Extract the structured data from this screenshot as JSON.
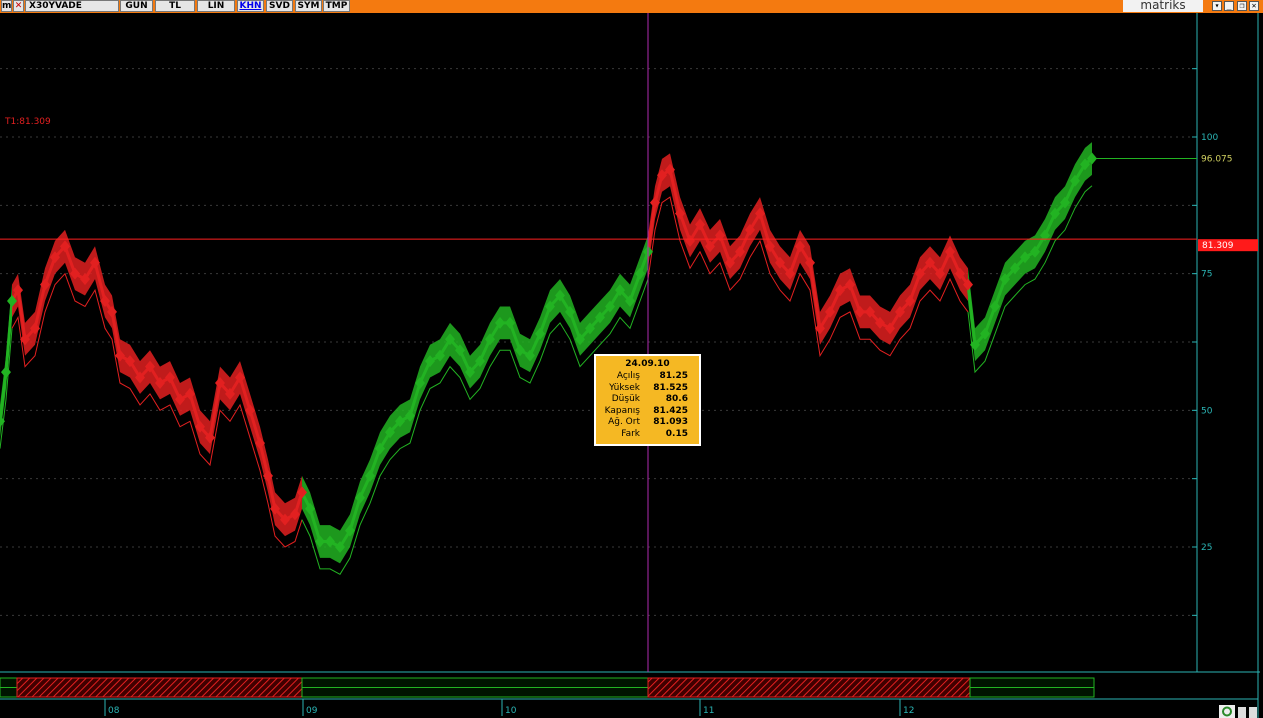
{
  "toolbar": {
    "symbol": "X30YVADE",
    "buttons": [
      "GUN",
      "TL",
      "LIN",
      "KHN",
      "SVD",
      "SYM",
      "TMP"
    ],
    "active_button": "KHN",
    "brand": "matriks"
  },
  "colors": {
    "titlebar": "#f47a10",
    "up": "#22b322",
    "down": "#e22020",
    "axis": "#2bb5b5",
    "trendline": "#ff2020",
    "cursor": "#b02cb0"
  },
  "chart_data": {
    "type": "line",
    "symbol": "X30YVADE",
    "style": "colored price band (green = rising, red = falling)",
    "ylim": [
      -10,
      120
    ],
    "y_ticks": [
      25,
      50,
      75,
      100
    ],
    "x_ticks": [
      "08",
      "09",
      "10",
      "11",
      "12"
    ],
    "series": [
      {
        "points": [
          [
            0,
            48
          ],
          [
            6,
            57
          ],
          [
            12,
            70
          ],
          [
            18,
            72
          ],
          [
            25,
            63
          ],
          [
            35,
            65
          ],
          [
            45,
            73
          ],
          [
            55,
            78
          ],
          [
            65,
            80
          ],
          [
            75,
            75
          ],
          [
            85,
            74
          ],
          [
            95,
            77
          ],
          [
            105,
            70
          ],
          [
            112,
            68
          ],
          [
            120,
            60
          ],
          [
            130,
            59
          ],
          [
            140,
            56
          ],
          [
            150,
            58
          ],
          [
            160,
            55
          ],
          [
            170,
            56
          ],
          [
            180,
            52
          ],
          [
            190,
            53
          ],
          [
            200,
            47
          ],
          [
            210,
            45
          ],
          [
            220,
            55
          ],
          [
            230,
            53
          ],
          [
            240,
            56
          ],
          [
            250,
            50
          ],
          [
            260,
            44
          ],
          [
            268,
            38
          ],
          [
            275,
            32
          ],
          [
            285,
            30
          ],
          [
            295,
            31
          ],
          [
            302,
            35
          ],
          [
            310,
            32
          ],
          [
            320,
            26
          ],
          [
            330,
            26
          ],
          [
            340,
            25
          ],
          [
            350,
            28
          ],
          [
            360,
            34
          ],
          [
            370,
            38
          ],
          [
            380,
            43
          ],
          [
            390,
            46
          ],
          [
            400,
            48
          ],
          [
            410,
            49
          ],
          [
            420,
            55
          ],
          [
            430,
            59
          ],
          [
            440,
            60
          ],
          [
            450,
            63
          ],
          [
            460,
            61
          ],
          [
            470,
            57
          ],
          [
            480,
            59
          ],
          [
            490,
            63
          ],
          [
            500,
            66
          ],
          [
            510,
            66
          ],
          [
            520,
            61
          ],
          [
            530,
            60
          ],
          [
            540,
            64
          ],
          [
            550,
            69
          ],
          [
            560,
            71
          ],
          [
            570,
            68
          ],
          [
            580,
            63
          ],
          [
            590,
            65
          ],
          [
            600,
            67
          ],
          [
            610,
            69
          ],
          [
            620,
            72
          ],
          [
            630,
            70
          ],
          [
            640,
            75
          ],
          [
            648,
            79
          ],
          [
            655,
            88
          ],
          [
            662,
            93
          ],
          [
            670,
            94
          ],
          [
            680,
            86
          ],
          [
            690,
            81
          ],
          [
            700,
            84
          ],
          [
            710,
            80
          ],
          [
            720,
            82
          ],
          [
            730,
            77
          ],
          [
            740,
            79
          ],
          [
            750,
            83
          ],
          [
            760,
            86
          ],
          [
            770,
            80
          ],
          [
            780,
            77
          ],
          [
            790,
            75
          ],
          [
            800,
            80
          ],
          [
            810,
            77
          ],
          [
            820,
            65
          ],
          [
            830,
            68
          ],
          [
            840,
            72
          ],
          [
            850,
            73
          ],
          [
            860,
            68
          ],
          [
            870,
            68
          ],
          [
            880,
            66
          ],
          [
            890,
            65
          ],
          [
            900,
            68
          ],
          [
            910,
            70
          ],
          [
            920,
            75
          ],
          [
            930,
            77
          ],
          [
            940,
            75
          ],
          [
            950,
            79
          ],
          [
            960,
            75
          ],
          [
            968,
            73
          ],
          [
            975,
            62
          ],
          [
            985,
            64
          ],
          [
            995,
            69
          ],
          [
            1005,
            74
          ],
          [
            1015,
            76
          ],
          [
            1025,
            78
          ],
          [
            1035,
            79
          ],
          [
            1045,
            82
          ],
          [
            1055,
            86
          ],
          [
            1065,
            88
          ],
          [
            1075,
            92
          ],
          [
            1085,
            95
          ],
          [
            1092,
            96.075
          ]
        ]
      }
    ],
    "segments": [
      {
        "start": 0,
        "end": 12,
        "direction": "up"
      },
      {
        "start": 12,
        "end": 302,
        "direction": "down"
      },
      {
        "start": 302,
        "end": 648,
        "direction": "up"
      },
      {
        "start": 648,
        "end": 968,
        "direction": "down"
      },
      {
        "start": 968,
        "end": 1092,
        "direction": "up"
      }
    ],
    "strip": [
      {
        "start": 0,
        "end": 17,
        "direction": "up"
      },
      {
        "start": 17,
        "end": 302,
        "direction": "down"
      },
      {
        "start": 302,
        "end": 648,
        "direction": "up"
      },
      {
        "start": 648,
        "end": 970,
        "direction": "down"
      },
      {
        "start": 970,
        "end": 1094,
        "direction": "up"
      }
    ],
    "trendline": {
      "label": "T1:81.309",
      "value": 81.309,
      "badge": "81.309"
    },
    "last_value": "96.075",
    "cursor": {
      "date": "24.09.10",
      "rows": [
        {
          "label": "Açılış",
          "value": "81.25"
        },
        {
          "label": "Yüksek",
          "value": "81.525"
        },
        {
          "label": "Düşük",
          "value": "80.6"
        },
        {
          "label": "Kapanış",
          "value": "81.425"
        },
        {
          "label": "Ağ. Ort",
          "value": "81.093"
        },
        {
          "label": "Fark",
          "value": "0.15"
        }
      ]
    }
  }
}
